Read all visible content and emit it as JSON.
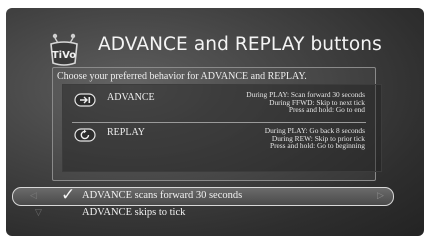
{
  "screen": {
    "logo_text": "TiVo",
    "title": "ADVANCE and REPLAY buttons"
  },
  "panel": {
    "instruction": "Choose your preferred behavior for ADVANCE and REPLAY.",
    "options": [
      {
        "name": "ADVANCE",
        "icon": "advance-icon",
        "lines": [
          "During PLAY: Scan forward 30 seconds",
          "During FFWD: Skip to next tick",
          "Press and hold: Go to end"
        ]
      },
      {
        "name": "REPLAY",
        "icon": "replay-icon",
        "lines": [
          "During PLAY: Go back 8 seconds",
          "During REW: Skip to prior tick",
          "Press and hold: Go to beginning"
        ]
      }
    ]
  },
  "menu": {
    "items": [
      {
        "label": "ADVANCE scans forward 30 seconds",
        "selected": true
      },
      {
        "label": "ADVANCE skips to tick",
        "selected": false
      }
    ],
    "left_arrow": "◁",
    "right_arrow": "▷",
    "down_arrow": "▽",
    "check_glyph": "✓"
  }
}
